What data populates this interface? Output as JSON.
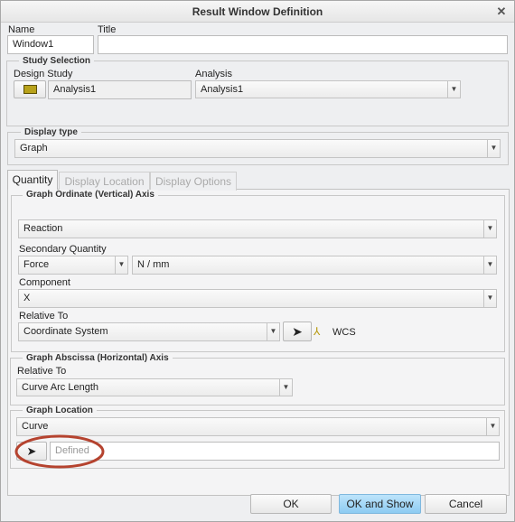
{
  "window": {
    "title": "Result Window Definition",
    "close_icon": "close-icon"
  },
  "name": {
    "label": "Name",
    "value": "Window1"
  },
  "title_field": {
    "label": "Title",
    "value": ""
  },
  "study_selection": {
    "legend": "Study Selection",
    "design_study_label": "Design Study",
    "design_study_value": "Analysis1",
    "analysis_label": "Analysis",
    "analysis_value": "Analysis1"
  },
  "display_type": {
    "legend": "Display type",
    "value": "Graph"
  },
  "tabs": [
    {
      "label": "Quantity",
      "active": true
    },
    {
      "label": "Display Location",
      "active": false
    },
    {
      "label": "Display Options",
      "active": false
    }
  ],
  "ordinate": {
    "legend": "Graph Ordinate (Vertical) Axis",
    "quantity": "Reaction",
    "secondary_label": "Secondary Quantity",
    "secondary_value": "Force",
    "units": "N / mm",
    "component_label": "Component",
    "component_value": "X",
    "relative_label": "Relative To",
    "relative_value": "Coordinate System",
    "csys": "WCS"
  },
  "abscissa": {
    "legend": "Graph Abscissa (Horizontal) Axis",
    "relative_label": "Relative To",
    "relative_value": "Curve Arc Length"
  },
  "location": {
    "legend": "Graph Location",
    "value": "Curve",
    "selection_placeholder": "Defined"
  },
  "buttons": {
    "ok": "OK",
    "ok_show": "OK and Show",
    "cancel": "Cancel"
  },
  "colors": {
    "highlight_ellipse": "#b5432f",
    "primary_button": "#9fd4f5"
  }
}
